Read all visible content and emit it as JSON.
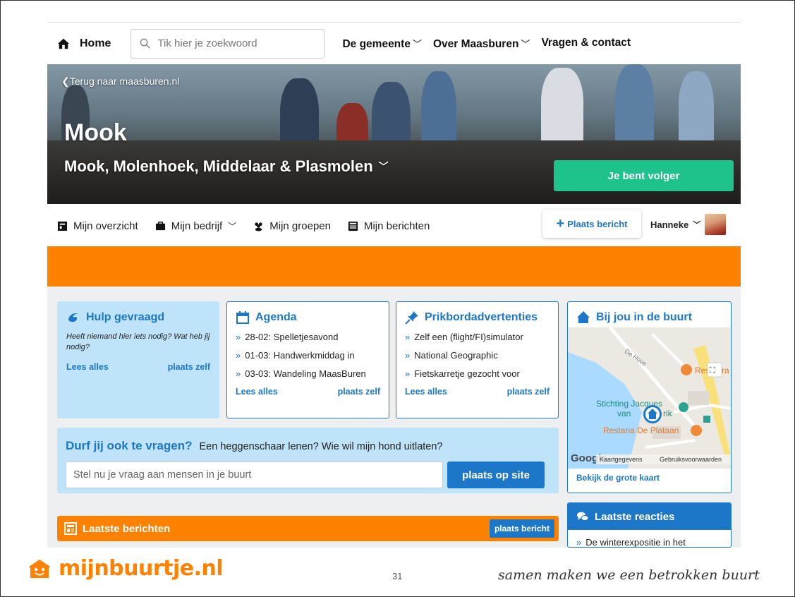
{
  "topnav": {
    "home_label": "Home",
    "search_placeholder": "Tik hier je zoekwoord",
    "links": [
      {
        "label": "De gemeente",
        "has_dropdown": true
      },
      {
        "label": "Over Maasburen",
        "has_dropdown": true
      },
      {
        "label": "Vragen & contact",
        "has_dropdown": false
      }
    ]
  },
  "hero": {
    "back_link": "Terug naar maasburen.nl",
    "title": "Mook",
    "subtitle": "Mook, Molenhoek, Middelaar & Plasmolen",
    "follow_button": "Je bent volger"
  },
  "subnav": {
    "items": [
      {
        "label": "Mijn overzicht",
        "icon": "dashboard-icon"
      },
      {
        "label": "Mijn bedrijf",
        "icon": "briefcase-icon",
        "has_dropdown": true
      },
      {
        "label": "Mijn groepen",
        "icon": "group-icon"
      },
      {
        "label": "Mijn berichten",
        "icon": "messages-icon"
      }
    ],
    "post_button": "Plaats bericht",
    "user_name": "Hanneke"
  },
  "hulp": {
    "title": "Hulp gevraagd",
    "description": "Heeft niemand hier iets nodig? Wat heb jij nodig?",
    "read_all": "Lees alles",
    "post_own": "plaats zelf"
  },
  "agenda": {
    "title": "Agenda",
    "items": [
      "28-02: Spelletjesavond",
      "01-03: Handwerkmiddag in",
      "03-03: Wandeling MaasBuren"
    ],
    "read_all": "Lees alles",
    "post_own": "plaats zelf"
  },
  "prikbord": {
    "title": "Prikbordadvertenties",
    "items": [
      "Zelf een (flight/FI)simulator",
      "National Geographic",
      "Fietskarretje gezocht voor"
    ],
    "read_all": "Lees alles",
    "post_own": "plaats zelf"
  },
  "buurt": {
    "title": "Bij jou in de buurt",
    "map_labels": {
      "street": "De Hove",
      "restaurant": "Restaura",
      "poi_1": "Stichting Jacques",
      "poi_2": "van",
      "poi_3": "rik",
      "restaria": "Restaria De Plataan",
      "google": "Google",
      "map_data": "Kaartgegevens",
      "terms": "Gebruiksvoorwaarden"
    },
    "view_map": "Bekijk de grote kaart"
  },
  "durf": {
    "heading": "Durf jij ook te vragen?",
    "examples": "Een heggenschaar lenen? Wie wil mijn hond uitlaten?",
    "input_placeholder": "Stel nu je vraag aan mensen in je buurt",
    "button": "plaats op site"
  },
  "laatste_berichten": {
    "title": "Laatste berichten",
    "button": "plaats bericht"
  },
  "laatste_reacties": {
    "title": "Laatste reacties",
    "items": [
      "De winterexpositie in het"
    ]
  },
  "footer": {
    "brand": "mijnbuurtje.nl",
    "page_number": "31",
    "tagline": "samen maken we een betrokken buurt"
  },
  "colors": {
    "accent_blue": "#1d77c8",
    "accent_orange": "#ff8100",
    "follow_green": "#1ec28b",
    "light_blue": "#bfe3f8"
  }
}
